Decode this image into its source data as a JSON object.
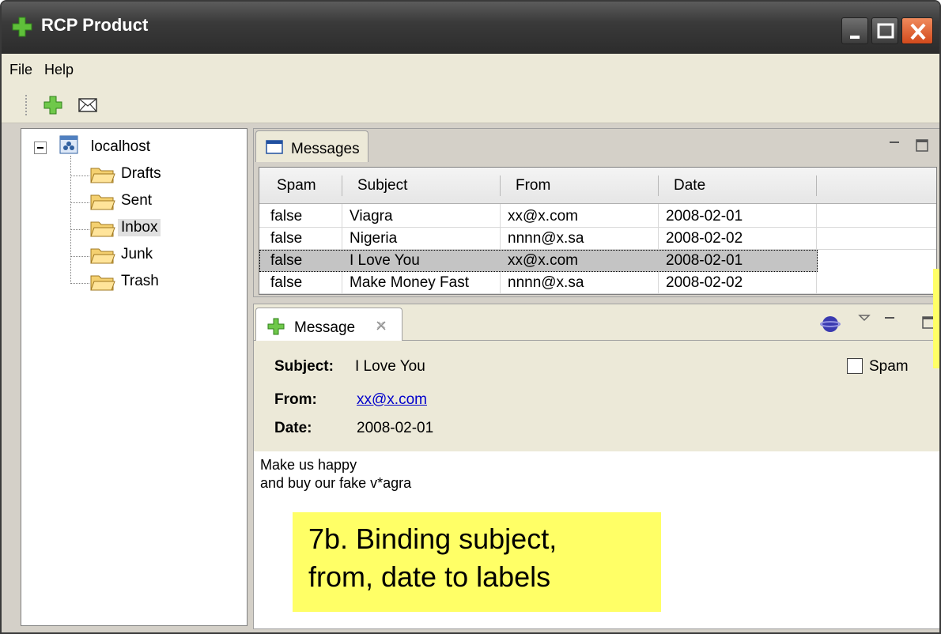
{
  "window": {
    "title": "RCP Product"
  },
  "menu": {
    "file": "File",
    "help": "Help"
  },
  "tree": {
    "root": "localhost",
    "folders": [
      {
        "label": "Drafts"
      },
      {
        "label": "Sent"
      },
      {
        "label": "Inbox",
        "selected": true
      },
      {
        "label": "Junk"
      },
      {
        "label": "Trash"
      }
    ]
  },
  "messages": {
    "tab_label": "Messages",
    "columns": [
      "Spam",
      "Subject",
      "From",
      "Date"
    ],
    "rows": [
      {
        "spam": "false",
        "subject": "Viagra",
        "from": "xx@x.com",
        "date": "2008-02-01"
      },
      {
        "spam": "false",
        "subject": "Nigeria",
        "from": "nnnn@x.sa",
        "date": "2008-02-02"
      },
      {
        "spam": "false",
        "subject": "I Love You",
        "from": "xx@x.com",
        "date": "2008-02-01",
        "selected": true
      },
      {
        "spam": "false",
        "subject": "Make Money Fast",
        "from": "nnnn@x.sa",
        "date": "2008-02-02"
      }
    ]
  },
  "message": {
    "tab_label": "Message",
    "subject_label": "Subject:",
    "subject_value": "I Love You",
    "from_label": "From:",
    "from_value": "xx@x.com",
    "date_label": "Date:",
    "date_value": "2008-02-01",
    "spam_label": "Spam",
    "spam_checked": false,
    "body_line1": "Make us happy",
    "body_line2": "and buy our fake v*agra"
  },
  "annotation": {
    "line1": "7b. Binding subject,",
    "line2": "from, date to labels"
  },
  "colors": {
    "annotation": "#ffff66",
    "link": "#0000cc",
    "titlebar": "#3a3a3a"
  },
  "icons": [
    "plus-icon",
    "envelope-icon",
    "server-icon",
    "folder-icon",
    "window-icon",
    "globe-icon",
    "close-tab-icon"
  ]
}
